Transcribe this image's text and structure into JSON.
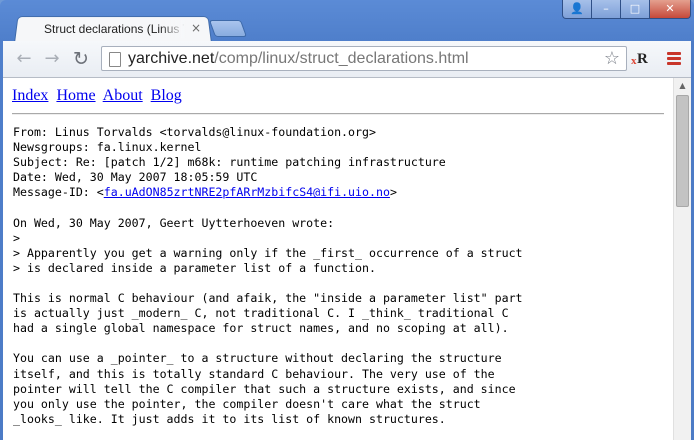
{
  "browser": {
    "tab_title": "Struct declarations (Linus Torvalds)",
    "tab_close": "×",
    "url_host": "yarchive.net",
    "url_path": "/comp/linux/struct_declarations.html",
    "controls": {
      "user": "👤",
      "min": "–",
      "max": "□",
      "close": "✕"
    },
    "nav": {
      "back": "←",
      "forward": "→",
      "reload": "↻"
    },
    "bookmark_star": "☆",
    "ext_label_x": "x",
    "ext_label_r": "R",
    "accent_menu": "#c8352a"
  },
  "site_nav": [
    {
      "label": "Index"
    },
    {
      "label": "Home"
    },
    {
      "label": "About"
    },
    {
      "label": "Blog"
    }
  ],
  "message": {
    "header": [
      "From: Linus Torvalds <torvalds@linux-foundation.org>",
      "Newsgroups: fa.linux.kernel",
      "Subject: Re: [patch 1/2] m68k: runtime patching infrastructure",
      "Date: Wed, 30 May 2007 18:05:59 UTC"
    ],
    "message_id_prefix": "Message-ID: <",
    "message_id_link": "fa.uAdON85zrtNRE2pfARrMzbifcS4@ifi.uio.no",
    "message_id_suffix": ">",
    "body": [
      "",
      "On Wed, 30 May 2007, Geert Uytterhoeven wrote:",
      ">",
      "> Apparently you get a warning only if the _first_ occurrence of a struct",
      "> is declared inside a parameter list of a function.",
      "",
      "This is normal C behaviour (and afaik, the \"inside a parameter list\" part",
      "is actually just _modern_ C, not traditional C. I _think_ traditional C",
      "had a single global namespace for struct names, and no scoping at all).",
      "",
      "You can use a _pointer_ to a structure without declaring the structure",
      "itself, and this is totally standard C behaviour. The very use of the",
      "pointer will tell the C compiler that such a structure exists, and since",
      "you only use the pointer, the compiler doesn't care what the struct",
      "_looks_ like. It just adds it to its list of known structures."
    ]
  }
}
